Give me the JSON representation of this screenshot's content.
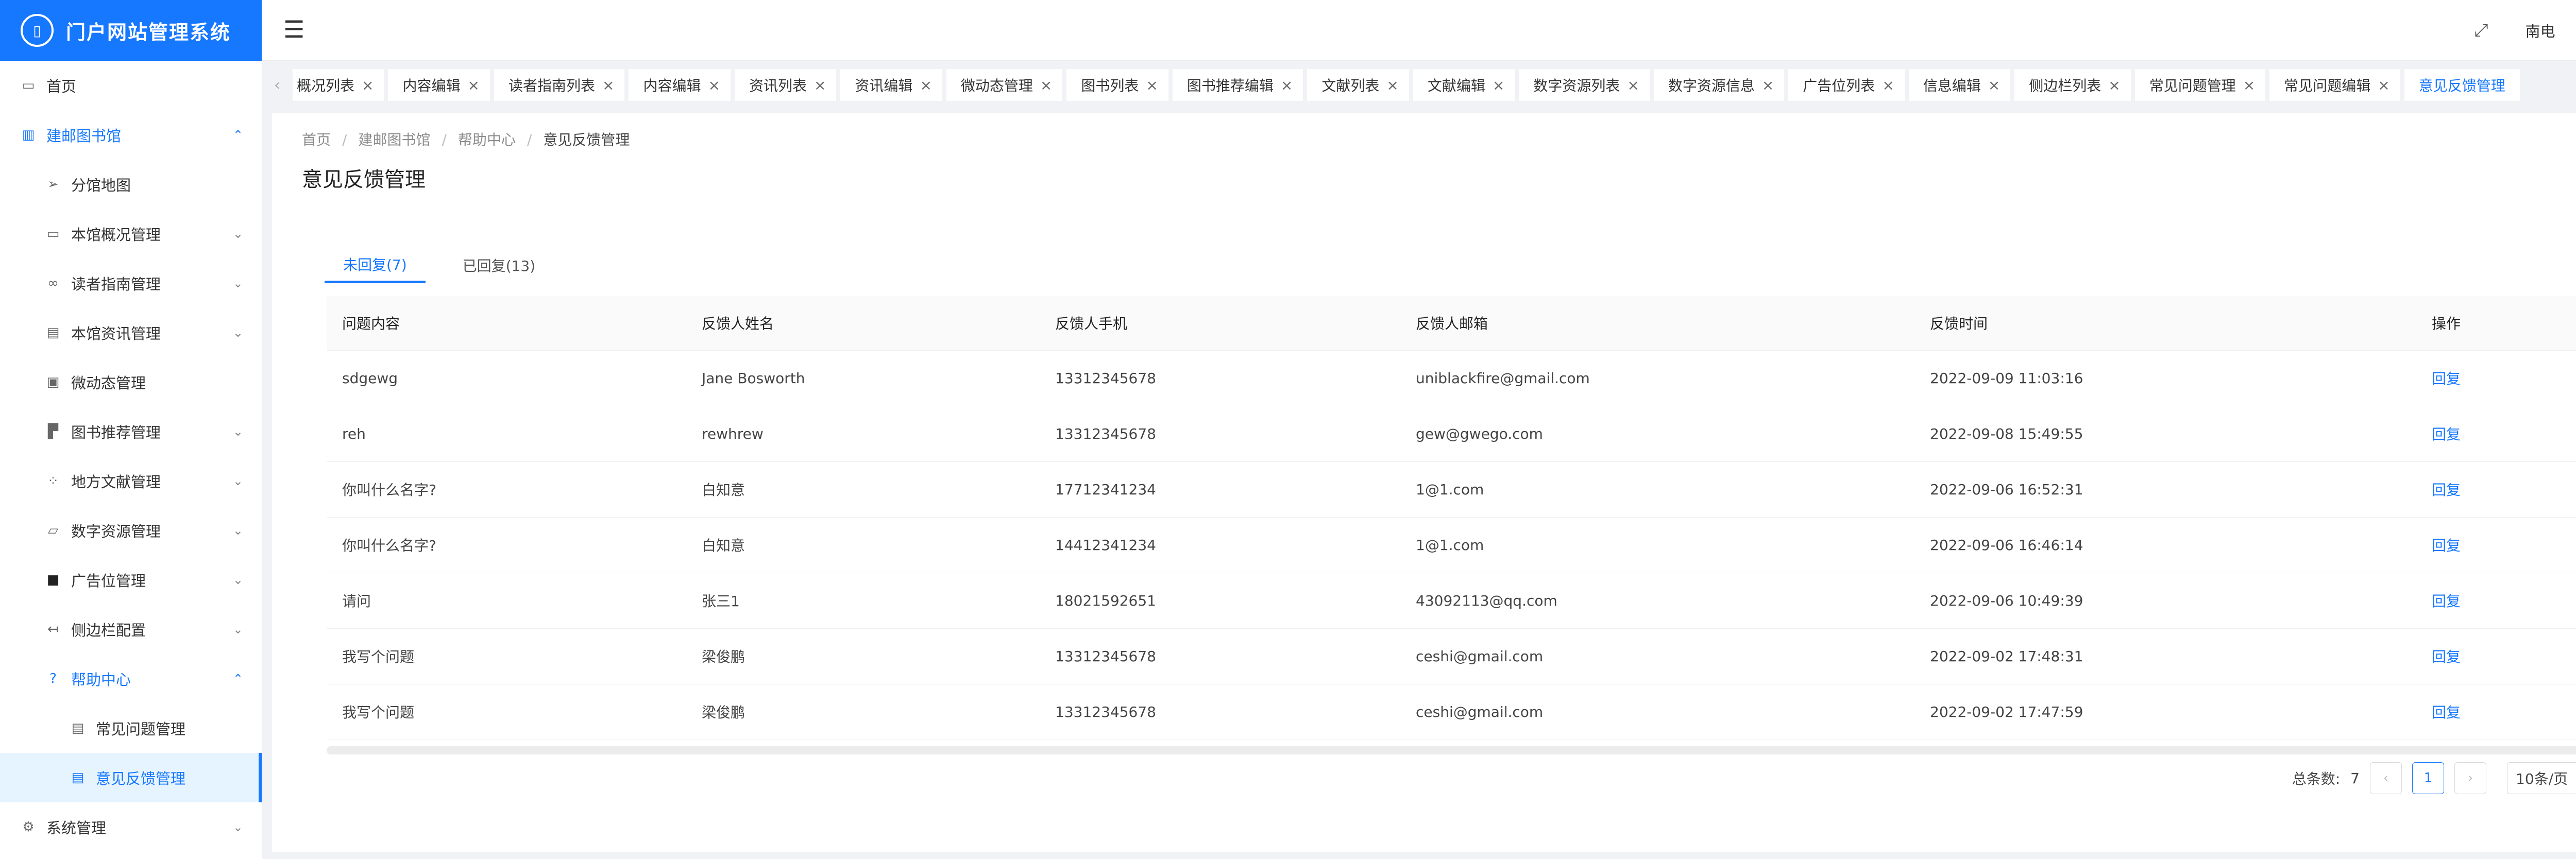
{
  "app": {
    "title": "门户网站管理系统"
  },
  "sidebar": {
    "items": [
      {
        "label": "首页",
        "icon": "monitor-icon"
      },
      {
        "label": "建邮图书馆",
        "icon": "book-icon"
      },
      {
        "label": "分馆地图",
        "icon": "send-icon"
      },
      {
        "label": "本馆概况管理",
        "icon": "card-icon"
      },
      {
        "label": "读者指南管理",
        "icon": "link-icon"
      },
      {
        "label": "本馆资讯管理",
        "icon": "doc-icon"
      },
      {
        "label": "微动态管理",
        "icon": "picture-icon"
      },
      {
        "label": "图书推荐管理",
        "icon": "layout-icon"
      },
      {
        "label": "地方文献管理",
        "icon": "grid-icon"
      },
      {
        "label": "数字资源管理",
        "icon": "image-icon"
      },
      {
        "label": "广告位管理",
        "icon": "square-icon"
      },
      {
        "label": "侧边栏配置",
        "icon": "arrow-left-icon"
      },
      {
        "label": "帮助中心",
        "icon": "question-icon"
      },
      {
        "label": "常见问题管理",
        "icon": "doc-icon"
      },
      {
        "label": "意见反馈管理",
        "icon": "doc-icon"
      },
      {
        "label": "系统管理",
        "icon": "gear-icon"
      }
    ]
  },
  "header": {
    "collapse_icon": "menu-fold-icon",
    "fullscreen_icon": "fullscreen-icon",
    "user": "南电",
    "language_icon": "globe-icon"
  },
  "tabs": [
    "概况列表",
    "内容编辑",
    "读者指南列表",
    "内容编辑",
    "资讯列表",
    "资讯编辑",
    "微动态管理",
    "图书列表",
    "图书推荐编辑",
    "文献列表",
    "文献编辑",
    "数字资源列表",
    "数字资源信息",
    "广告位列表",
    "信息编辑",
    "侧边栏列表",
    "常见问题管理",
    "常见问题编辑",
    "意见反馈管理"
  ],
  "breadcrumb": [
    "首页",
    "建邮图书馆",
    "帮助中心",
    "意见反馈管理"
  ],
  "page": {
    "title": "意见反馈管理"
  },
  "reply_tabs": {
    "unreplied": "未回复(7)",
    "replied": "已回复(13)"
  },
  "table": {
    "columns": [
      "问题内容",
      "反馈人姓名",
      "反馈人手机",
      "反馈人邮箱",
      "反馈时间",
      "操作"
    ],
    "rows": [
      [
        "sdgewg",
        "Jane Bosworth",
        "13312345678",
        "uniblackfire@gmail.com",
        "2022-09-09 11:03:16",
        "回复"
      ],
      [
        "reh",
        "rewhrew",
        "13312345678",
        "gew@gwego.com",
        "2022-09-08 15:49:55",
        "回复"
      ],
      [
        "你叫什么名字?",
        "白知意",
        "17712341234",
        "1@1.com",
        "2022-09-06 16:52:31",
        "回复"
      ],
      [
        "你叫什么名字?",
        "白知意",
        "14412341234",
        "1@1.com",
        "2022-09-06 16:46:14",
        "回复"
      ],
      [
        "请问",
        "张三1",
        "18021592651",
        "43092113@qq.com",
        "2022-09-06 10:49:39",
        "回复"
      ],
      [
        "我写个问题",
        "梁俊鹏",
        "13312345678",
        "ceshi@gmail.com",
        "2022-09-02 17:48:31",
        "回复"
      ],
      [
        "我写个问题",
        "梁俊鹏",
        "13312345678",
        "ceshi@gmail.com",
        "2022-09-02 17:47:59",
        "回复"
      ]
    ]
  },
  "pagination": {
    "total_label": "总条数:",
    "total": "7",
    "current_page": "1",
    "page_size": "10条/页"
  },
  "colors": {
    "primary": "#1677ff",
    "bg": "#f0f2f5"
  }
}
